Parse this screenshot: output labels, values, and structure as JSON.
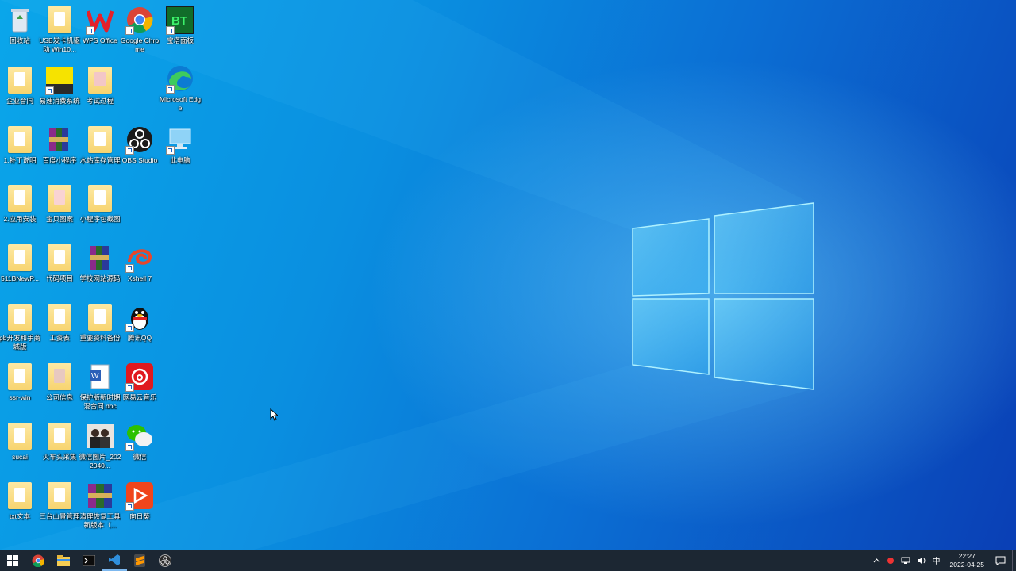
{
  "desktop": {
    "icons": [
      {
        "label": "回收站",
        "icon": "recycle-bin-icon"
      },
      {
        "label": "USB发卡机驱动 Win10...",
        "icon": "folder-icon"
      },
      {
        "label": "WPS Office",
        "icon": "wps-icon"
      },
      {
        "label": "Google Chrome",
        "icon": "chrome-icon"
      },
      {
        "label": "宝塔面板",
        "icon": "bt-panel-icon"
      },
      {
        "label": "企业合同",
        "icon": "folder-icon"
      },
      {
        "label": "易速消费系统",
        "icon": "witeasy-icon"
      },
      {
        "label": "考试过程",
        "icon": "folder-icon"
      },
      {
        "label": "Microsoft Edge",
        "icon": "edge-icon"
      },
      {
        "label": "1.补丁说明",
        "icon": "folder-icon"
      },
      {
        "label": "百度小程序",
        "icon": "winrar-icon"
      },
      {
        "label": "水站库存管理",
        "icon": "folder-icon"
      },
      {
        "label": "OBS Studio",
        "icon": "obs-icon"
      },
      {
        "label": "此电脑",
        "icon": "this-pc-icon"
      },
      {
        "label": "2.应用安装",
        "icon": "folder-icon"
      },
      {
        "label": "宝贝图案",
        "icon": "folder-icon"
      },
      {
        "label": "小程序包截图",
        "icon": "folder-icon"
      },
      {
        "label": "511BNewP...",
        "icon": "folder-icon"
      },
      {
        "label": "代码项目",
        "icon": "folder-icon"
      },
      {
        "label": "学校网站源码",
        "icon": "winrar-icon"
      },
      {
        "label": "Xshell 7",
        "icon": "xshell-icon"
      },
      {
        "label": "pb开发和手商城版",
        "icon": "folder-icon"
      },
      {
        "label": "工资表",
        "icon": "folder-icon"
      },
      {
        "label": "重要资料备份",
        "icon": "folder-icon"
      },
      {
        "label": "腾讯QQ",
        "icon": "qq-icon"
      },
      {
        "label": "ssr-win",
        "icon": "folder-icon"
      },
      {
        "label": "公司信息",
        "icon": "folder-icon"
      },
      {
        "label": "保护版新时期混合同.doc",
        "icon": "word-doc-icon"
      },
      {
        "label": "网易云音乐",
        "icon": "netease-music-icon"
      },
      {
        "label": "sucai",
        "icon": "folder-icon"
      },
      {
        "label": "火车头采集",
        "icon": "folder-icon"
      },
      {
        "label": "微信图片_2022040...",
        "icon": "photo-icon"
      },
      {
        "label": "微信",
        "icon": "wechat-icon"
      },
      {
        "label": "txt文本",
        "icon": "folder-icon"
      },
      {
        "label": "三台山景管理",
        "icon": "folder-icon"
      },
      {
        "label": "清理恢复工具新版本（...",
        "icon": "winrar-icon"
      },
      {
        "label": "向日葵",
        "icon": "sunlogin-icon"
      }
    ]
  },
  "taskbar": {
    "apps": [
      {
        "icon": "start-icon"
      },
      {
        "icon": "chrome-icon"
      },
      {
        "icon": "file-explorer-icon"
      },
      {
        "icon": "terminal-icon"
      },
      {
        "icon": "vscode-icon"
      },
      {
        "icon": "sublime-icon"
      },
      {
        "icon": "obs-icon"
      }
    ],
    "tray": {
      "ime": "中",
      "time": "22:27",
      "date": "2022-04-25"
    }
  },
  "colors": {
    "taskbar": "#1c2733",
    "desktop_accent": "#0a8fe0"
  }
}
